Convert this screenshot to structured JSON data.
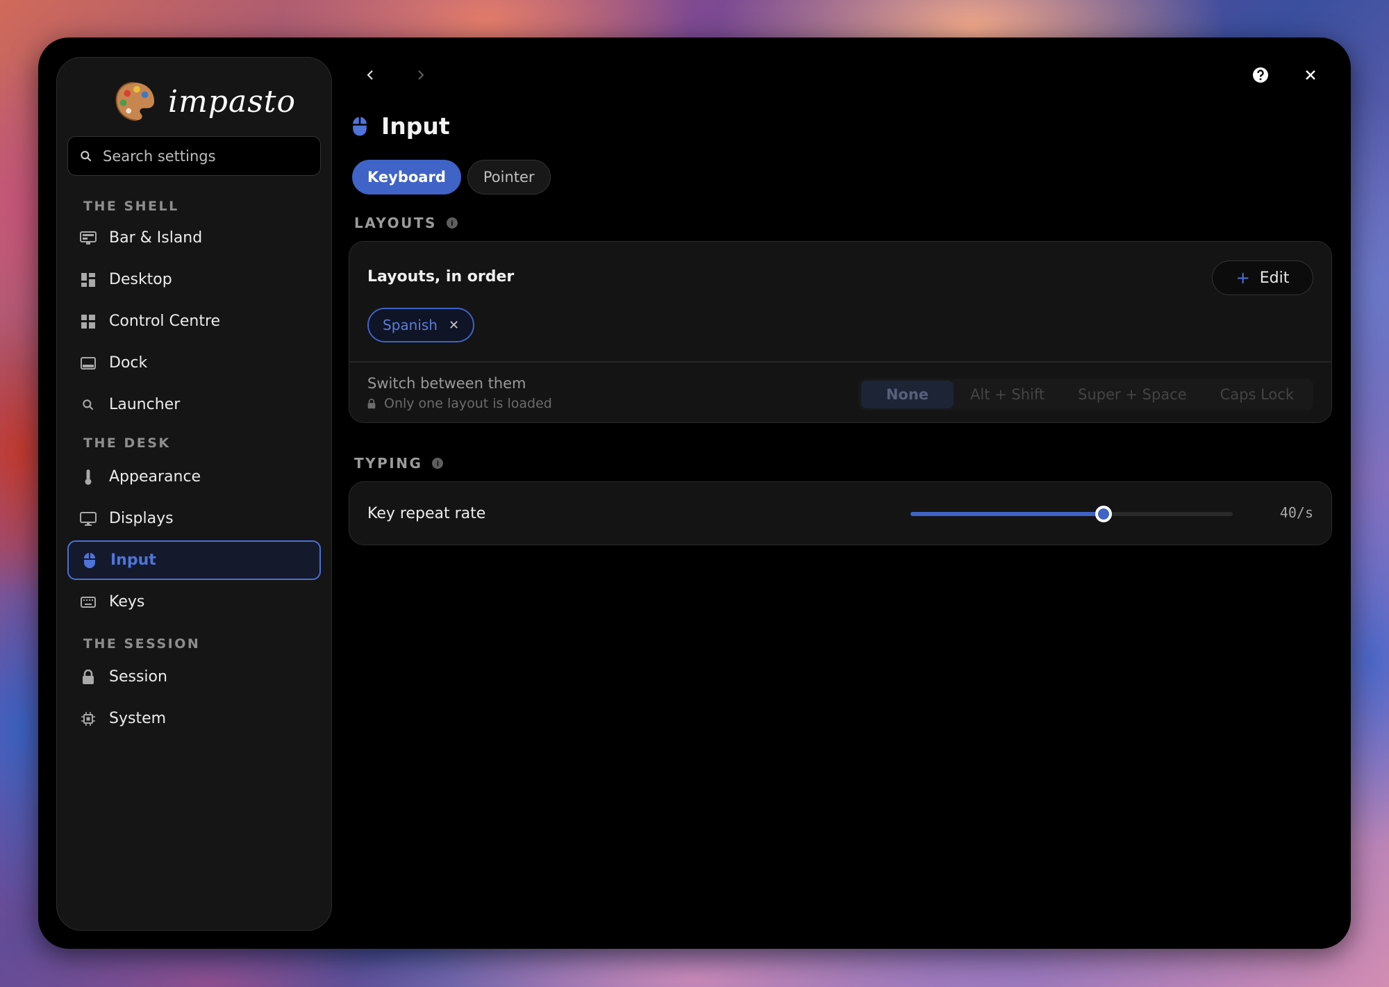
{
  "app": {
    "name": "impasto",
    "search_placeholder": "Search settings"
  },
  "sidebar": {
    "sections": [
      {
        "label": "THE SHELL"
      },
      {
        "label": "THE DESK"
      },
      {
        "label": "THE SESSION"
      }
    ],
    "items": [
      {
        "label": "Bar & Island",
        "icon": "monitor-bar-icon"
      },
      {
        "label": "Desktop",
        "icon": "grid-icon"
      },
      {
        "label": "Control Centre",
        "icon": "grid-icon"
      },
      {
        "label": "Dock",
        "icon": "dock-icon"
      },
      {
        "label": "Launcher",
        "icon": "search-icon"
      },
      {
        "label": "Appearance",
        "icon": "thermometer-icon"
      },
      {
        "label": "Displays",
        "icon": "monitor-icon"
      },
      {
        "label": "Input",
        "icon": "mouse-icon",
        "active": true
      },
      {
        "label": "Keys",
        "icon": "keyboard-icon"
      },
      {
        "label": "Session",
        "icon": "lock-icon"
      },
      {
        "label": "System",
        "icon": "chip-icon"
      }
    ]
  },
  "page": {
    "title": "Input",
    "tabs": [
      {
        "label": "Keyboard",
        "active": true
      },
      {
        "label": "Pointer",
        "active": false
      }
    ]
  },
  "layouts": {
    "section_label": "LAYOUTS",
    "card_title": "Layouts, in order",
    "edit_label": "Edit",
    "chips": [
      "Spanish"
    ],
    "switch_label": "Switch between them",
    "switch_note": "Only one layout is loaded",
    "switch_options": [
      "None",
      "Alt + Shift",
      "Super + Space",
      "Caps Lock"
    ],
    "switch_selected": "None"
  },
  "typing": {
    "section_label": "TYPING",
    "repeat_label": "Key repeat rate",
    "repeat_value_text": "40/s",
    "repeat_fraction": 0.6
  },
  "colors": {
    "accent": "#3f63c6",
    "accent_text": "#4e74d9",
    "window_bg": "#000000",
    "card_bg": "#141414"
  }
}
